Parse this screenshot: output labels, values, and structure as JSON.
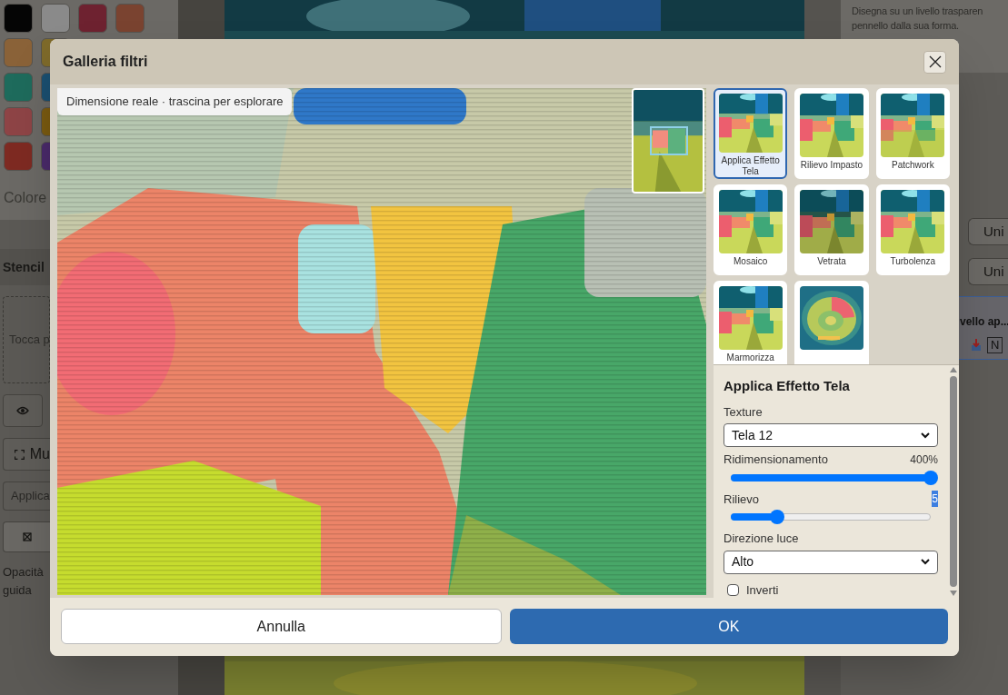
{
  "background": {
    "swatch_rows": [
      [
        {
          "color": "#050505"
        },
        {
          "color": "#8a8a8a"
        },
        {
          "color": "#6e2230"
        },
        {
          "color": "#7a4330"
        }
      ],
      [
        {
          "color": "#8a6238"
        },
        {
          "color": "#7e6a2a"
        }
      ],
      [
        {
          "color": "#1e6b5c"
        },
        {
          "color": "#1a4f70"
        }
      ],
      [
        {
          "color": "#8e4446"
        },
        {
          "color": "#7a5a10"
        }
      ],
      [
        {
          "color": "#7e2a22"
        },
        {
          "color": "#4a2a6a"
        }
      ]
    ],
    "color_label": "Colore",
    "stencil": {
      "title": "Stencil",
      "drop_hint": "Tocca p",
      "mode_button": "Mu",
      "apply_field": "Applica",
      "opacity_label": "Opacità guida"
    },
    "hint_lines": [
      "Disegna su un livello trasparen",
      "pennello dalla sua forma."
    ],
    "side_buttons": [
      "Uni",
      "Uni"
    ],
    "layer": {
      "name": "vello ap...",
      "field": "N"
    }
  },
  "dialog": {
    "title": "Galleria filtri",
    "preview_hint": "Dimensione reale · trascina per esplorare",
    "filters": [
      {
        "label": "Applica Effetto Tela",
        "selected": true
      },
      {
        "label": "Rilievo Impasto",
        "selected": false
      },
      {
        "label": "Patchwork",
        "selected": false
      },
      {
        "label": "Mosaico",
        "selected": false
      },
      {
        "label": "Vetrata",
        "selected": false
      },
      {
        "label": "Turbolenza",
        "selected": false
      },
      {
        "label": "Marmorizza",
        "selected": false
      },
      {
        "selected": false
      }
    ],
    "settings": {
      "title": "Applica Effetto Tela",
      "fields": [
        {
          "kind": "select",
          "label": "Texture",
          "value": "Tela 12"
        },
        {
          "kind": "slider",
          "label": "Ridimensionamento",
          "reading": "400%",
          "level": 1,
          "reading_selected": false
        },
        {
          "kind": "slider",
          "label": "Rilievo",
          "reading": "5",
          "level": 0.23,
          "reading_selected": true
        },
        {
          "kind": "select",
          "label": "Direzione luce",
          "value": "Alto"
        },
        {
          "kind": "checkbox",
          "label": "Inverti",
          "checked": false
        }
      ]
    },
    "buttons": {
      "cancel": "Annulla",
      "ok": "OK"
    }
  }
}
